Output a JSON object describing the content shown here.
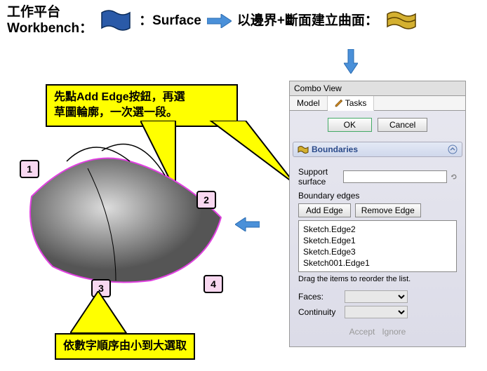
{
  "header": {
    "workbench_zh": "工作平台",
    "workbench_en": "Workbench",
    "colon1": "：",
    "surface_label": "：Surface",
    "right_text": "以邊界+斷面建立曲面：",
    "colon2": "："
  },
  "callout1_line1": "先點Add Edge按鈕，再選",
  "callout1_line2": "草圖輪廓，一次選一段。",
  "callout2": "依數字順序由小到大選取",
  "numbers": [
    "1",
    "2",
    "3",
    "4"
  ],
  "combo": {
    "title": "Combo View",
    "tab_model": "Model",
    "tab_tasks": "Tasks",
    "ok": "OK",
    "cancel": "Cancel",
    "section": "Boundaries",
    "support_surface": "Support surface",
    "boundary_edges": "Boundary edges",
    "add_edge": "Add Edge",
    "remove_edge": "Remove Edge",
    "edges": [
      "Sketch.Edge2",
      "Sketch.Edge1",
      "Sketch.Edge3",
      "Sketch001.Edge1"
    ],
    "drag_hint": "Drag the items to reorder the list.",
    "faces": "Faces:",
    "continuity": "Continuity",
    "accept": "Accept",
    "ignore": "Ignore"
  }
}
